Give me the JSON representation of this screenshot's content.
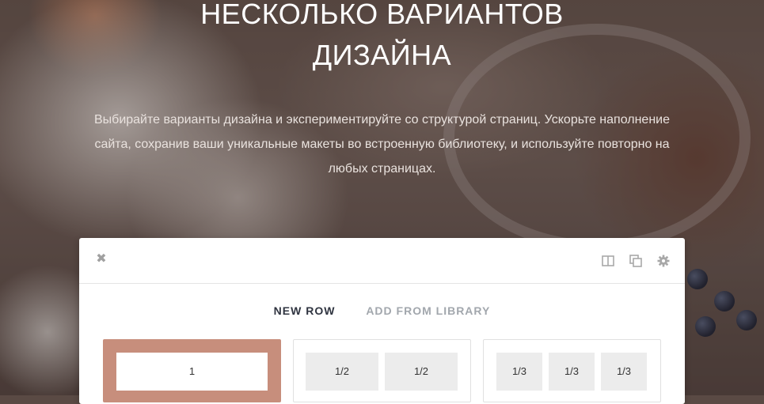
{
  "hero": {
    "title_line1": "НЕСКОЛЬКО ВАРИАНТОВ",
    "title_line2": "ДИЗАЙНА",
    "description": "Выбирайте варианты дизайна и экспериментируйте со структурой страниц. Ускорьте наполнение сайта, сохранив ваши уникальные макеты во встроенную библиотеку, и используйте повторно на любых страницах."
  },
  "modal": {
    "close_icon": "close-icon",
    "toolbar_icons": [
      "columns-icon",
      "duplicate-icon",
      "gear-icon"
    ],
    "tabs": [
      {
        "label": "NEW ROW",
        "active": true
      },
      {
        "label": "ADD FROM LIBRARY",
        "active": false
      }
    ],
    "layouts": [
      {
        "columns": [
          "1"
        ],
        "selected": true
      },
      {
        "columns": [
          "1/2",
          "1/2"
        ],
        "selected": false
      },
      {
        "columns": [
          "1/3",
          "1/3",
          "1/3"
        ],
        "selected": false
      }
    ]
  },
  "colors": {
    "accent": "#c78e7c",
    "tab_active": "#2f3440",
    "tab_inactive": "#a2a7ad"
  }
}
